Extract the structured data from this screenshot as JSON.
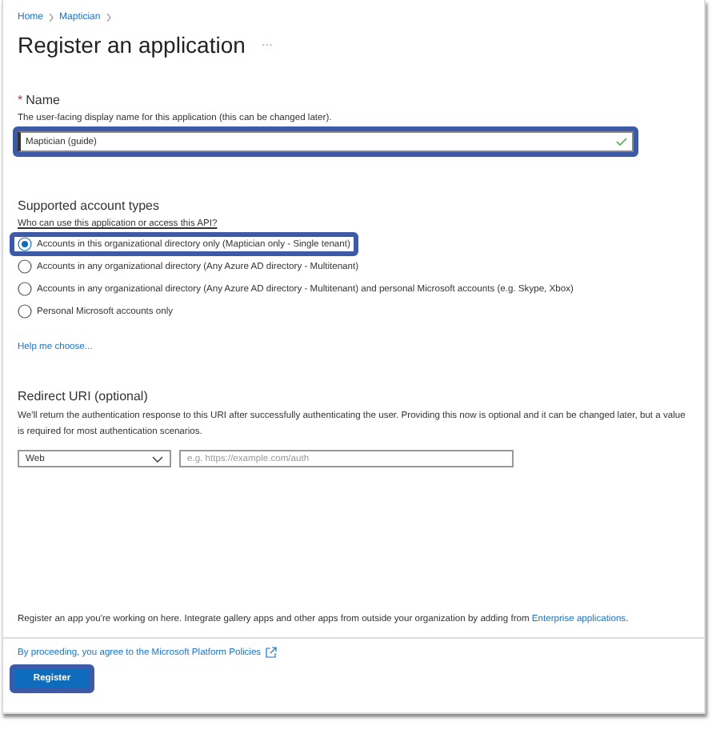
{
  "breadcrumb": [
    "Home",
    "Maptician"
  ],
  "title": "Register an application",
  "more": "···",
  "name_section": {
    "required_mark": "*",
    "label": "Name",
    "description": "The user-facing display name for this application (this can be changed later).",
    "value": "Maptician (guide)",
    "valid": true,
    "highlighted": true
  },
  "account_types": {
    "heading": "Supported account types",
    "question": "Who can use this application or access this API?",
    "options": [
      {
        "label": "Accounts in this organizational directory only (Maptician only - Single tenant)",
        "selected": true,
        "highlighted": true
      },
      {
        "label": "Accounts in any organizational directory (Any Azure AD directory - Multitenant)",
        "selected": false,
        "highlighted": false
      },
      {
        "label": "Accounts in any organizational directory (Any Azure AD directory - Multitenant) and personal Microsoft accounts (e.g. Skype, Xbox)",
        "selected": false,
        "highlighted": false
      },
      {
        "label": "Personal Microsoft accounts only",
        "selected": false,
        "highlighted": false
      }
    ],
    "help_link": "Help me choose..."
  },
  "redirect_uri": {
    "heading": "Redirect URI (optional)",
    "description": "We'll return the authentication response to this URI after successfully authenticating the user. Providing this now is optional and it can be changed later, but a value is required for most authentication scenarios.",
    "platform": "Web",
    "placeholder": "e.g. https://example.com/auth"
  },
  "footer_note": {
    "text": "Register an app you're working on here. Integrate gallery apps and other apps from outside your organization by adding from ",
    "link": "Enterprise applications",
    "end": "."
  },
  "policies_link": "By proceeding, you agree to the Microsoft Platform Policies",
  "register_button": {
    "label": "Register",
    "highlighted": true
  }
}
